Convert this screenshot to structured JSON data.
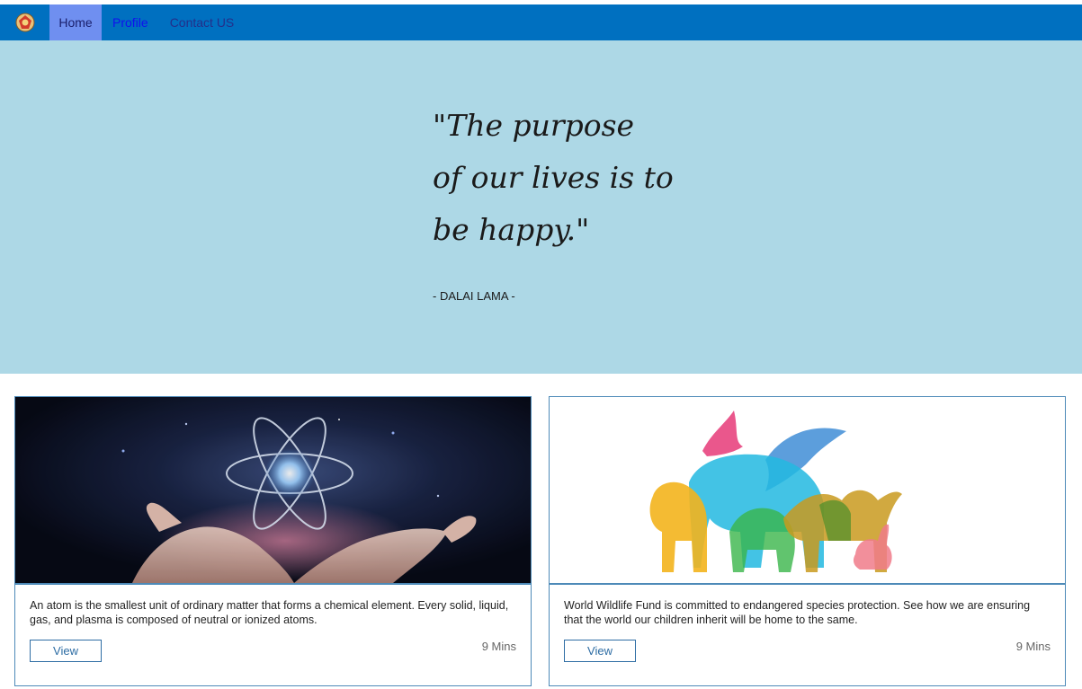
{
  "nav": {
    "logo_icon": "emblem-logo-icon",
    "items": [
      {
        "label": "Home",
        "active": true
      },
      {
        "label": "Profile"
      },
      {
        "label": "Contact US"
      }
    ],
    "colors": {
      "bar": "#0070c0",
      "active": "#6f8ff0"
    }
  },
  "hero": {
    "quote": "\"The purpose\nof our lives is to\nbe happy.\"",
    "author": "- DALAI LAMA -",
    "background": "#add8e6"
  },
  "cards": [
    {
      "image": "atom-hands-image",
      "text": "An atom is the smallest unit of ordinary matter that forms a chemical element. Every solid, liquid, gas, and plasma is composed of neutral or ionized atoms.",
      "button_label": "View",
      "duration": "9 Mins"
    },
    {
      "image": "wildlife-animals-image",
      "text": "World Wildlife Fund is committed to endangered species protection. See how we are ensuring that the world our children inherit will be home to the same.",
      "button_label": "View",
      "duration": "9 Mins"
    }
  ]
}
